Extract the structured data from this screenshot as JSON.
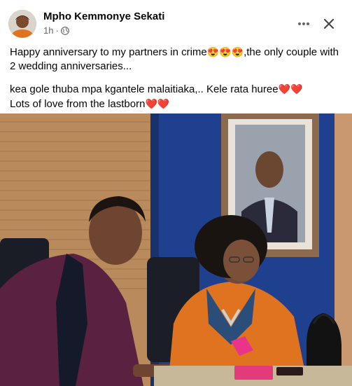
{
  "post": {
    "author": "Mpho Kemmonye Sekati",
    "time": "1h",
    "separator": "·",
    "visibility_icon": "globe-icon",
    "more_icon": "more-horizontal-icon",
    "close_icon": "close-icon",
    "text": {
      "line1": "Happy  anniversary to my partners in crime",
      "line1_emojis": "😍😍😍",
      "line1_rest": ",the only couple with 2 wedding anniversaries...",
      "line2": "kea gole thuba mpa kgantele malaitiaka,.. Kele rata huree",
      "line2_emojis": "❤️❤️",
      "line3": "Lots of love from the lastborn",
      "line3_emojis": "❤️❤️"
    },
    "photo_description_icon": "photo"
  },
  "colors": {
    "accent_text": "#050505",
    "secondary_text": "#65676b",
    "heart": "#e02424"
  }
}
